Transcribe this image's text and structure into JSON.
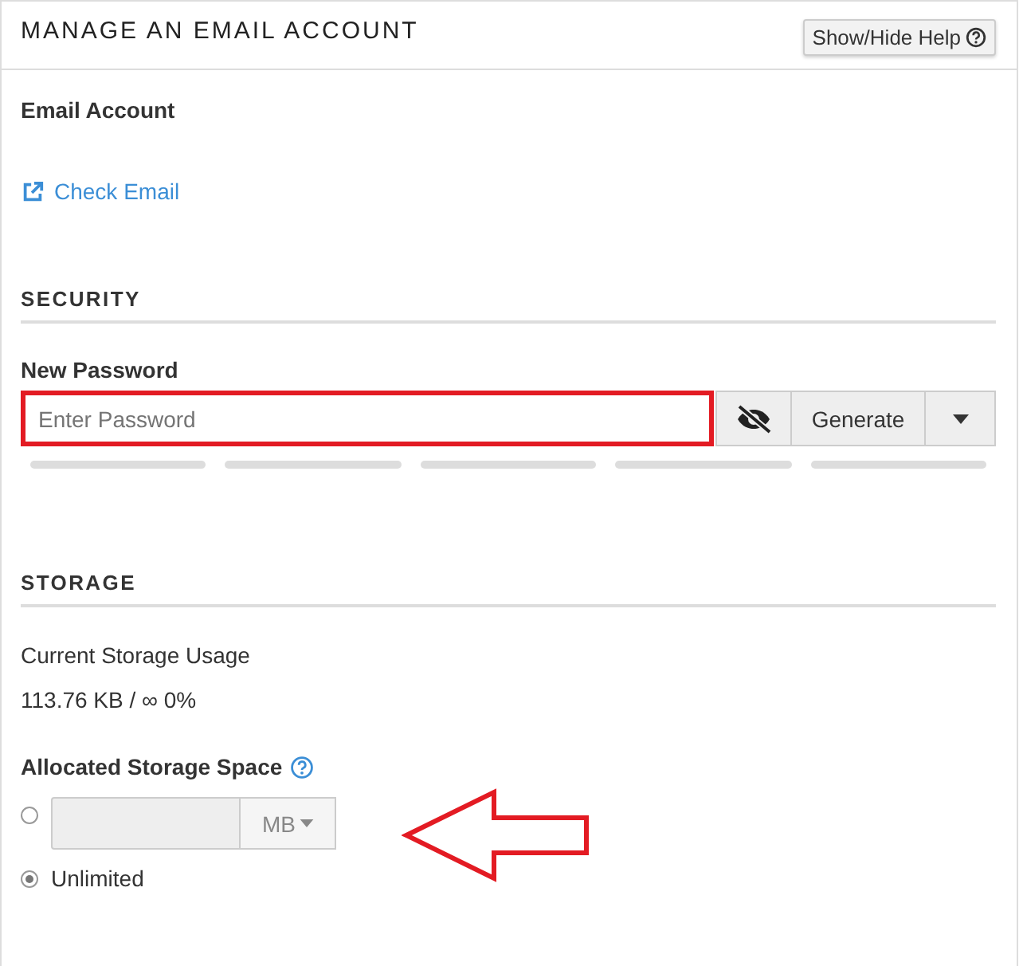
{
  "panel": {
    "title": "MANAGE AN EMAIL ACCOUNT",
    "help_button": "Show/Hide Help"
  },
  "account": {
    "label": "Email Account",
    "link": "Check Email"
  },
  "security": {
    "heading": "SECURITY",
    "password_label": "New Password",
    "placeholder": "Enter Password",
    "highlighted": true,
    "generate_button": "Generate",
    "strength": {
      "level": 0
    }
  },
  "storage": {
    "heading": "STORAGE",
    "usage_label": "Current Storage Usage",
    "usage_value": "113.76 KB / ∞ 0%",
    "allocated_label": "Allocated Storage Space",
    "options": [
      {
        "kind": "quota",
        "selected": false,
        "unit": "MB",
        "disabled": true
      },
      {
        "kind": "unlimited",
        "selected": true,
        "label": "Unlimited"
      }
    ]
  },
  "annotation": {
    "kind": "arrow",
    "color": "#e31b23"
  }
}
